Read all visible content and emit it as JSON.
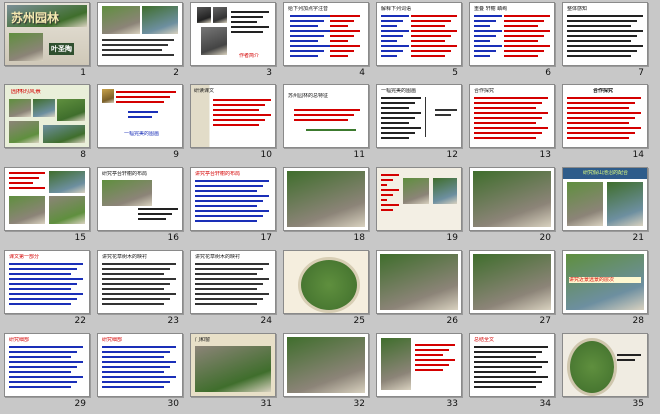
{
  "colors": {
    "background": "#c8c8c8",
    "slide": "#ffffff",
    "border": "#8a8a8a",
    "accent_red": "#d40000",
    "accent_blue": "#1a2fb8",
    "green": "#3c7a2e",
    "orange": "#e08a1a"
  },
  "slides": [
    {
      "n": "1",
      "title": "苏州园林",
      "sub": "叶圣陶"
    },
    {
      "n": "2",
      "text": "苏州园林"
    },
    {
      "n": "3",
      "text": "作者简介"
    },
    {
      "n": "4",
      "text": "给下列加点字注音"
    },
    {
      "n": "5",
      "text": "解释下列词语"
    },
    {
      "n": "6",
      "text": "重叠 轩榭 嶙峋"
    },
    {
      "n": "7",
      "text": "整体感知"
    },
    {
      "n": "8",
      "text": "园林的风景"
    },
    {
      "n": "9",
      "text": "一幅完美的图画"
    },
    {
      "n": "10",
      "text": "研读课文"
    },
    {
      "n": "11",
      "text": "苏州园林的总特征"
    },
    {
      "n": "12",
      "text": "一幅完美的图画"
    },
    {
      "n": "13",
      "text": "合作探究"
    },
    {
      "n": "14",
      "text": "合作探究"
    },
    {
      "n": "15",
      "text": "亭台轩榭"
    },
    {
      "n": "16",
      "text": "研究亭台轩榭的布局"
    },
    {
      "n": "17",
      "text": "讲究亭台轩榭的布局"
    },
    {
      "n": "18",
      "text": "园林图片"
    },
    {
      "n": "19",
      "text": "讲究假山池沼的配合"
    },
    {
      "n": "20",
      "text": "园林图片"
    },
    {
      "n": "21",
      "text": "研究假山池沼的配合"
    },
    {
      "n": "22",
      "text": "课文第一部分"
    },
    {
      "n": "23",
      "text": "讲究花草树木的映衬"
    },
    {
      "n": "24",
      "text": "讲究花草树木的映衬"
    },
    {
      "n": "25",
      "text": "花墙和廊子"
    },
    {
      "n": "26",
      "text": "园林图片"
    },
    {
      "n": "27",
      "text": "园林图片"
    },
    {
      "n": "28",
      "text": "讲究近景远景的层次"
    },
    {
      "n": "29",
      "text": "研究细部"
    },
    {
      "n": "30",
      "text": "研究细部"
    },
    {
      "n": "31",
      "text": "门和窗"
    },
    {
      "n": "32",
      "text": "园林图片"
    },
    {
      "n": "33",
      "text": "颜色"
    },
    {
      "n": "34",
      "text": "总结全文"
    },
    {
      "n": "35",
      "text": "结束"
    }
  ]
}
